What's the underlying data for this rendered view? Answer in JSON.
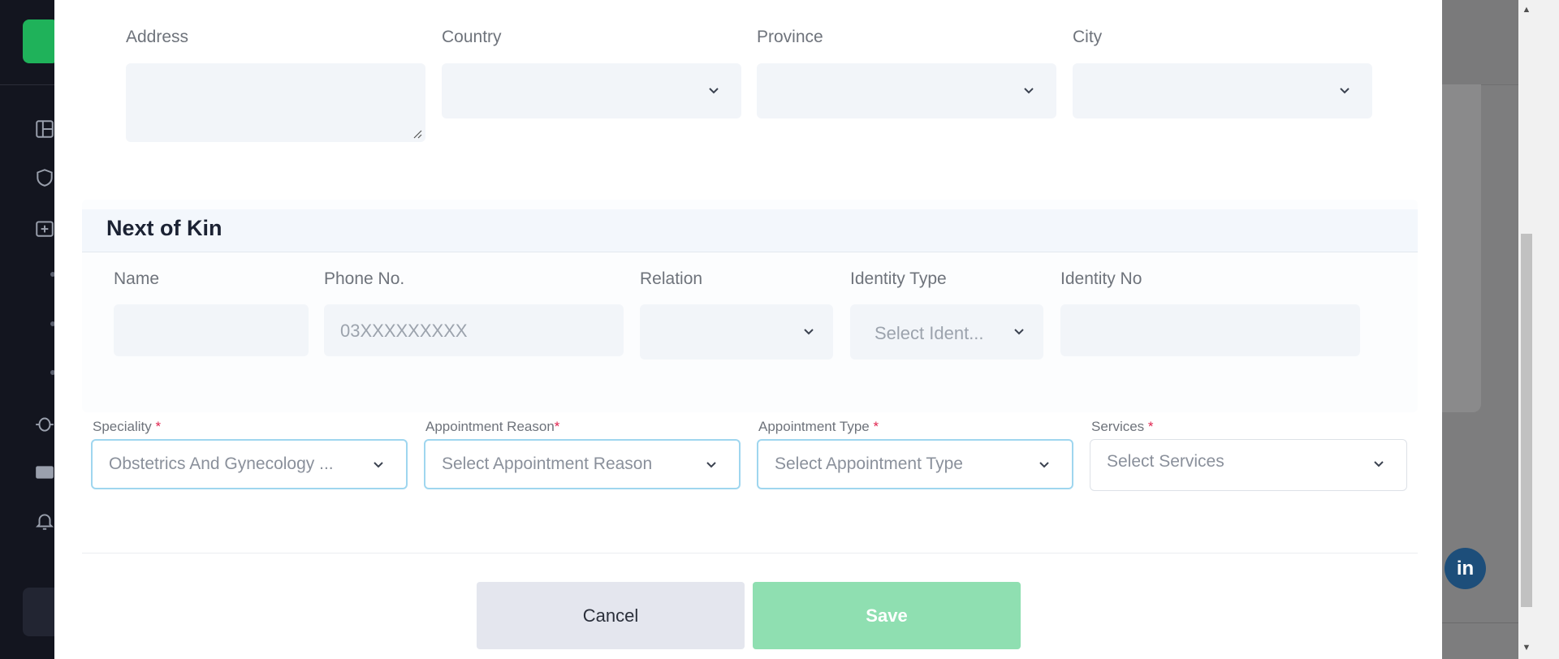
{
  "address_section": {
    "address_label": "Address",
    "country_label": "Country",
    "province_label": "Province",
    "city_label": "City"
  },
  "next_of_kin": {
    "title": "Next of Kin",
    "name_label": "Name",
    "phone_label": "Phone No.",
    "phone_placeholder": "03XXXXXXXXX",
    "relation_label": "Relation",
    "identity_type_label": "Identity Type",
    "identity_type_placeholder": "Select Ident...",
    "identity_no_label": "Identity No"
  },
  "appointment": {
    "speciality_label": "Speciality",
    "speciality_value": "Obstetrics And Gynecology ...",
    "reason_label": "Appointment Reason",
    "reason_placeholder": "Select Appointment Reason",
    "type_label": "Appointment Type",
    "type_placeholder": "Select Appointment Type",
    "services_label": "Services",
    "services_placeholder": "Select Services",
    "required_mark": "*"
  },
  "actions": {
    "cancel_label": "Cancel",
    "save_label": "Save"
  },
  "background": {
    "linkedin_label": "in"
  },
  "colors": {
    "accent_border": "#9fd6ef",
    "save_button": "#8fdfb1",
    "required": "#e0244f",
    "field_bg": "#f2f5f9"
  },
  "icons": [
    "chevron-down-icon",
    "resize-grip-icon",
    "linkedin-icon",
    "dashboard-icon",
    "shield-icon",
    "calendar-plus-icon",
    "bug-icon",
    "id-card-icon",
    "bell-icon"
  ]
}
